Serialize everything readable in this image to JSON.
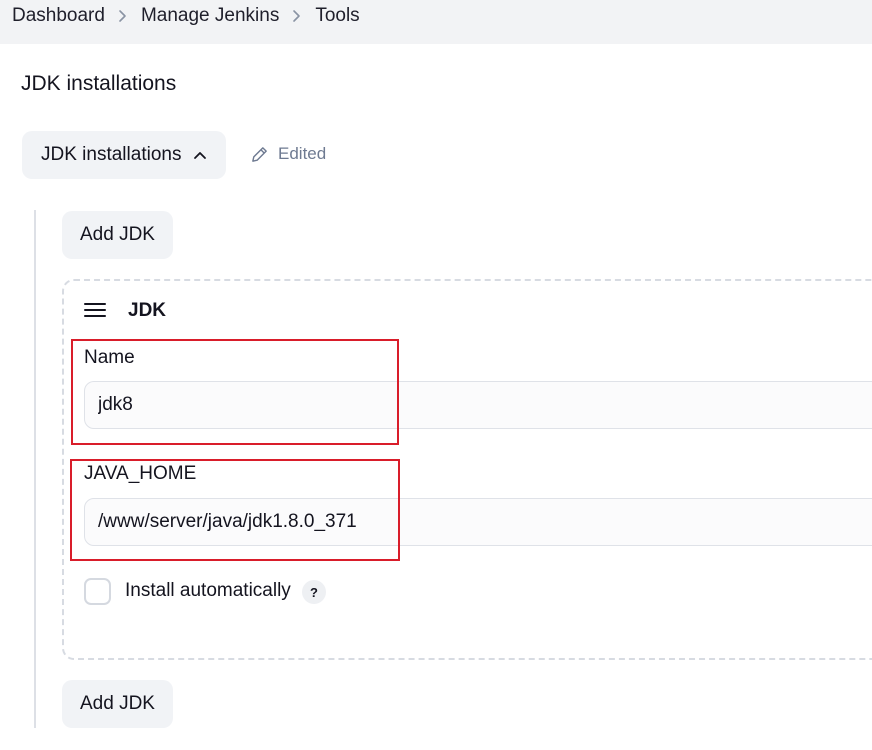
{
  "breadcrumb": {
    "items": [
      "Dashboard",
      "Manage Jenkins",
      "Tools"
    ],
    "separator_icon": "chevron-right-icon"
  },
  "section": {
    "title": "JDK installations",
    "toggle_label": "JDK installations",
    "toggle_icon": "chevron-up-icon",
    "edited_label": "Edited",
    "edited_icon": "pencil-icon"
  },
  "add_button": {
    "top_label": "Add JDK",
    "bottom_label": "Add JDK"
  },
  "jdk_card": {
    "title": "JDK",
    "drag_icon": "drag-handle-icon",
    "name_label": "Name",
    "name_value": "jdk8",
    "java_home_label": "JAVA_HOME",
    "java_home_value": "/www/server/java/jdk1.8.0_371",
    "install_auto_label": "Install automatically",
    "install_auto_checked": false,
    "help_label": "?"
  },
  "colors": {
    "highlight": "#d91d2a",
    "button_bg": "#f1f3f6",
    "muted_text": "#6e7a91"
  }
}
